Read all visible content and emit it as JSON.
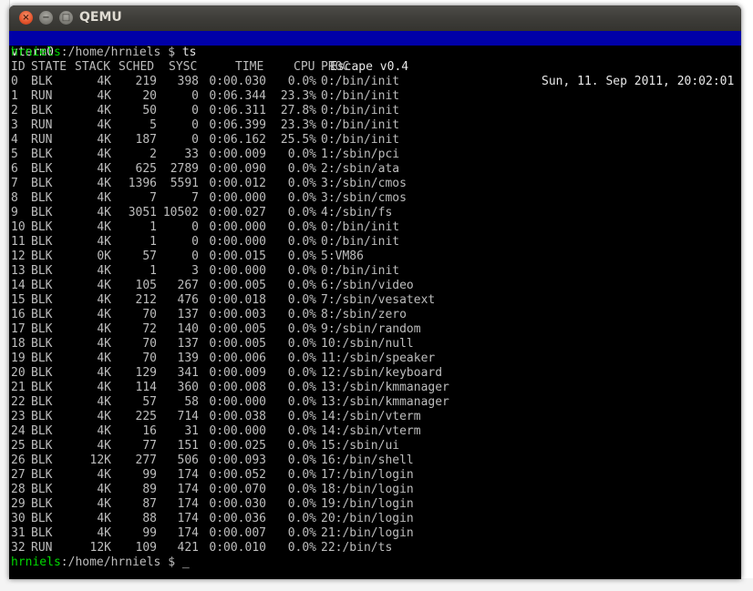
{
  "window": {
    "title": "QEMU",
    "close_glyph": "×",
    "min_glyph": "−",
    "max_glyph": "□"
  },
  "statusbar": {
    "terminal": "vterm0",
    "system": "Escape v0.4",
    "datetime": "Sun, 11. Sep 2011, 20:02:01"
  },
  "prompt1": {
    "user": "hrniels",
    "path": ":/home/hrniels $ ",
    "command": "ts"
  },
  "table": {
    "headers": [
      "ID",
      "STATE",
      "STACK",
      "SCHED",
      "SYSC",
      "TIME",
      "CPU",
      "PROC"
    ],
    "rows": [
      [
        "0",
        "BLK",
        "4K",
        "219",
        "398",
        "0:00.030",
        "0.0%",
        "0:/bin/init"
      ],
      [
        "1",
        "RUN",
        "4K",
        "20",
        "0",
        "0:06.344",
        "23.3%",
        "0:/bin/init"
      ],
      [
        "2",
        "BLK",
        "4K",
        "50",
        "0",
        "0:06.311",
        "27.8%",
        "0:/bin/init"
      ],
      [
        "3",
        "RUN",
        "4K",
        "5",
        "0",
        "0:06.399",
        "23.3%",
        "0:/bin/init"
      ],
      [
        "4",
        "RUN",
        "4K",
        "187",
        "0",
        "0:06.162",
        "25.5%",
        "0:/bin/init"
      ],
      [
        "5",
        "BLK",
        "4K",
        "2",
        "33",
        "0:00.009",
        "0.0%",
        "1:/sbin/pci"
      ],
      [
        "6",
        "BLK",
        "4K",
        "625",
        "2789",
        "0:00.090",
        "0.0%",
        "2:/sbin/ata"
      ],
      [
        "7",
        "BLK",
        "4K",
        "1396",
        "5591",
        "0:00.012",
        "0.0%",
        "3:/sbin/cmos"
      ],
      [
        "8",
        "BLK",
        "4K",
        "7",
        "7",
        "0:00.000",
        "0.0%",
        "3:/sbin/cmos"
      ],
      [
        "9",
        "BLK",
        "4K",
        "3051",
        "10502",
        "0:00.027",
        "0.0%",
        "4:/sbin/fs"
      ],
      [
        "10",
        "BLK",
        "4K",
        "1",
        "0",
        "0:00.000",
        "0.0%",
        "0:/bin/init"
      ],
      [
        "11",
        "BLK",
        "4K",
        "1",
        "0",
        "0:00.000",
        "0.0%",
        "0:/bin/init"
      ],
      [
        "12",
        "BLK",
        "0K",
        "57",
        "0",
        "0:00.015",
        "0.0%",
        "5:VM86"
      ],
      [
        "13",
        "BLK",
        "4K",
        "1",
        "3",
        "0:00.000",
        "0.0%",
        "0:/bin/init"
      ],
      [
        "14",
        "BLK",
        "4K",
        "105",
        "267",
        "0:00.005",
        "0.0%",
        "6:/sbin/video"
      ],
      [
        "15",
        "BLK",
        "4K",
        "212",
        "476",
        "0:00.018",
        "0.0%",
        "7:/sbin/vesatext"
      ],
      [
        "16",
        "BLK",
        "4K",
        "70",
        "137",
        "0:00.003",
        "0.0%",
        "8:/sbin/zero"
      ],
      [
        "17",
        "BLK",
        "4K",
        "72",
        "140",
        "0:00.005",
        "0.0%",
        "9:/sbin/random"
      ],
      [
        "18",
        "BLK",
        "4K",
        "70",
        "137",
        "0:00.005",
        "0.0%",
        "10:/sbin/null"
      ],
      [
        "19",
        "BLK",
        "4K",
        "70",
        "139",
        "0:00.006",
        "0.0%",
        "11:/sbin/speaker"
      ],
      [
        "20",
        "BLK",
        "4K",
        "129",
        "341",
        "0:00.009",
        "0.0%",
        "12:/sbin/keyboard"
      ],
      [
        "21",
        "BLK",
        "4K",
        "114",
        "360",
        "0:00.008",
        "0.0%",
        "13:/sbin/kmmanager"
      ],
      [
        "22",
        "BLK",
        "4K",
        "57",
        "58",
        "0:00.000",
        "0.0%",
        "13:/sbin/kmmanager"
      ],
      [
        "23",
        "BLK",
        "4K",
        "225",
        "714",
        "0:00.038",
        "0.0%",
        "14:/sbin/vterm"
      ],
      [
        "24",
        "BLK",
        "4K",
        "16",
        "31",
        "0:00.000",
        "0.0%",
        "14:/sbin/vterm"
      ],
      [
        "25",
        "BLK",
        "4K",
        "77",
        "151",
        "0:00.025",
        "0.0%",
        "15:/sbin/ui"
      ],
      [
        "26",
        "BLK",
        "12K",
        "277",
        "506",
        "0:00.093",
        "0.0%",
        "16:/bin/shell"
      ],
      [
        "27",
        "BLK",
        "4K",
        "99",
        "174",
        "0:00.052",
        "0.0%",
        "17:/bin/login"
      ],
      [
        "28",
        "BLK",
        "4K",
        "89",
        "174",
        "0:00.070",
        "0.0%",
        "18:/bin/login"
      ],
      [
        "29",
        "BLK",
        "4K",
        "87",
        "174",
        "0:00.030",
        "0.0%",
        "19:/bin/login"
      ],
      [
        "30",
        "BLK",
        "4K",
        "88",
        "174",
        "0:00.036",
        "0.0%",
        "20:/bin/login"
      ],
      [
        "31",
        "BLK",
        "4K",
        "99",
        "174",
        "0:00.007",
        "0.0%",
        "21:/bin/login"
      ],
      [
        "32",
        "RUN",
        "12K",
        "109",
        "421",
        "0:00.010",
        "0.0%",
        "22:/bin/ts"
      ]
    ]
  },
  "prompt2": {
    "user": "hrniels",
    "path": ":/home/hrniels $ ",
    "cursor": "_"
  },
  "colors": {
    "statusbar_bg": "#0000a8",
    "prompt_user": "#00d800",
    "terminal_fg": "#bdbdbd",
    "terminal_bg": "#000000"
  }
}
